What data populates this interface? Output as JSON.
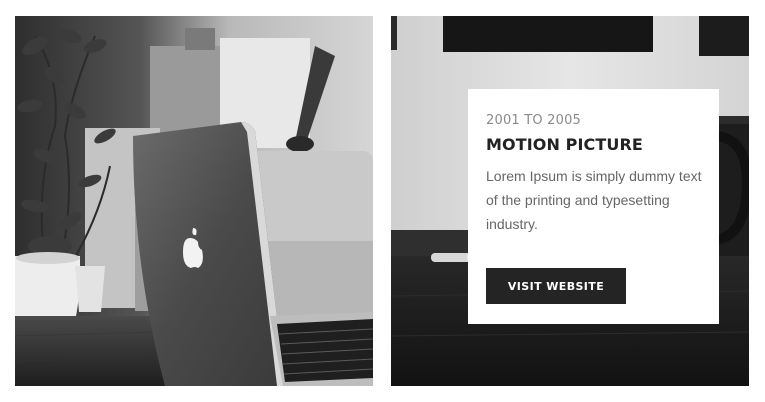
{
  "card": {
    "years": "2001 TO 2005",
    "title": "MOTION PICTURE",
    "description": "Lorem Ipsum is simply dummy text of the printing and typesetting industry.",
    "button_label": "VISIT WEBSITE"
  }
}
